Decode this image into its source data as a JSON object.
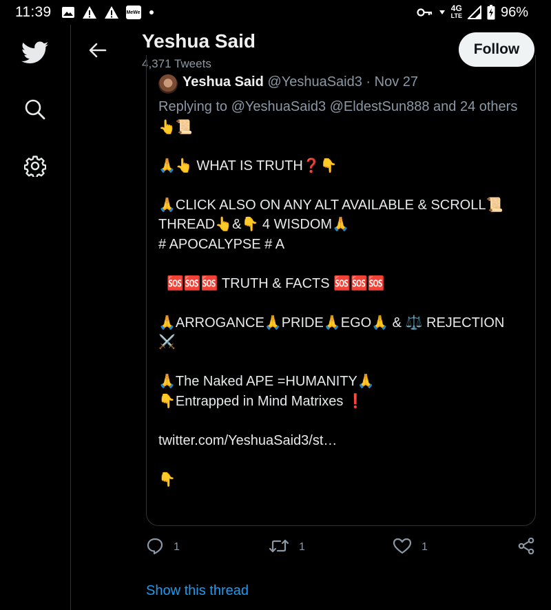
{
  "status_bar": {
    "time": "11:39",
    "network": "4G",
    "network_sub": "LTE",
    "battery": "96%",
    "app_badge": "MeWe"
  },
  "profile": {
    "name": "Yeshua Said",
    "tweet_count": "4,371 Tweets",
    "follow_label": "Follow"
  },
  "tweet": {
    "author_name": "Yeshua Said",
    "handle": "@YeshuaSaid3",
    "separator": "·",
    "date": "Nov 27",
    "replying_to": "Replying to @YeshuaSaid3 @EldestSun888 and 24 others",
    "lines": [
      "👆📜",
      "",
      "🙏👆 WHAT IS TRUTH❓👇",
      "",
      "🙏CLICK ALSO ON ANY ALT AVAILABLE & SCROLL📜",
      "THREAD👆&👇 4 WISDOM🙏",
      "# APOCALYPSE # A",
      "",
      "🆘🆘🆘 TRUTH & FACTS 🆘🆘🆘",
      "",
      "🙏ARROGANCE🙏PRIDE🙏EGO🙏 & ⚖️ REJECTION",
      "⚔️",
      "",
      "🙏The Naked APE =HUMANITY🙏",
      "👇Entrapped in Mind Matrixes ❗",
      "",
      "twitter.com/YeshuaSaid3/st…",
      "",
      "👇"
    ],
    "reply_count": "1",
    "retweet_count": "1",
    "like_count": "1"
  },
  "show_thread_label": "Show this thread",
  "icons": {
    "nav": [
      "twitter-bird-icon",
      "search-icon",
      "settings-gear-icon"
    ],
    "actions": [
      "reply-icon",
      "retweet-icon",
      "like-icon",
      "share-icon"
    ]
  },
  "colors": {
    "background": "#000000",
    "text": "#e7e9ea",
    "secondary": "#8b98a5",
    "accent": "#1d9bf0",
    "border": "#2f3336"
  }
}
